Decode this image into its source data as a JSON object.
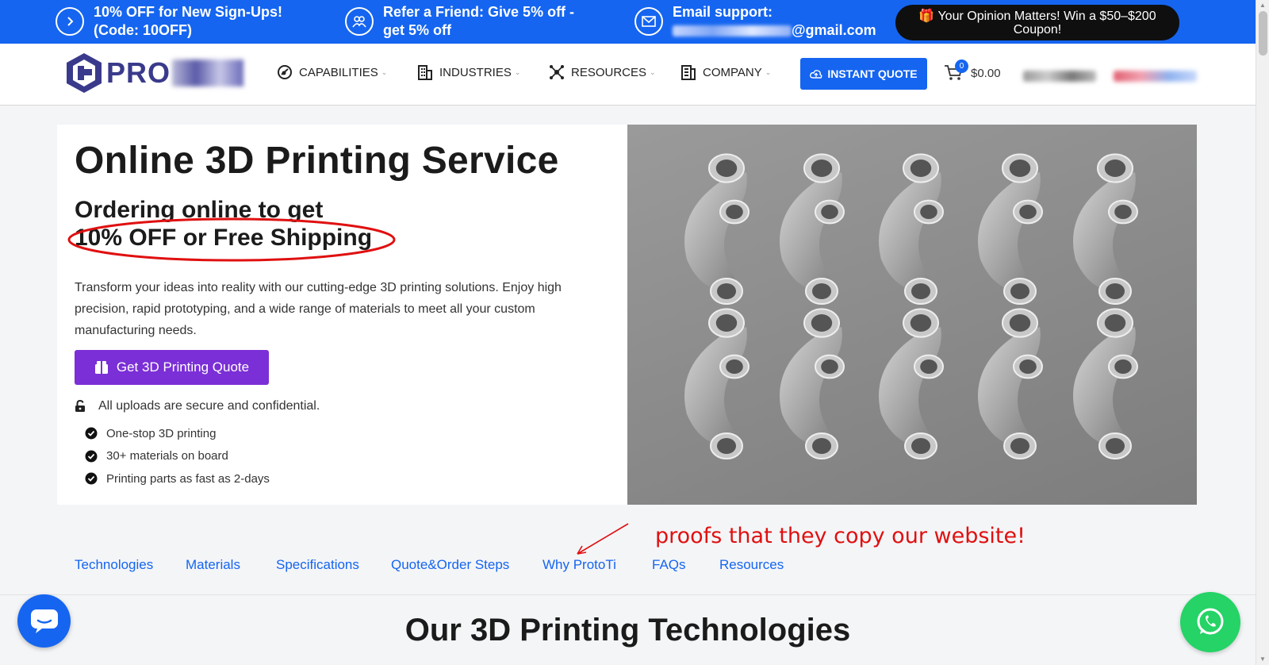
{
  "promo": {
    "item1": "10% OFF for New Sign-Ups! (Code: 10OFF)",
    "item2": "Refer a Friend: Give 5% off - get 5% off",
    "item3_label": "Email support:",
    "item3_email_suffix": "@gmail.com",
    "opinion": "🎁 Your Opinion Matters! Win a $50–$200 Coupon!"
  },
  "header": {
    "logo_text": "PRO",
    "nav": [
      "CAPABILITIES",
      "INDUSTRIES",
      "RESOURCES",
      "COMPANY"
    ],
    "instant_quote": "INSTANT QUOTE",
    "cart_count": "0",
    "cart_amount": "$0.00"
  },
  "hero": {
    "title": "Online 3D Printing Service",
    "subtitle_line1": "Ordering online to get",
    "subtitle_line2": "10% OFF or Free Shipping",
    "description": "Transform your ideas into reality with our cutting-edge 3D printing solutions. Enjoy high precision, rapid prototyping, and a wide range of materials to meet all your custom manufacturing needs.",
    "cta": "Get 3D Printing Quote",
    "secure_note": "All uploads are secure and confidential.",
    "checklist": [
      "One-stop 3D printing",
      "30+ materials on board",
      "Printing parts as fast as 2-days"
    ]
  },
  "tabs": [
    "Technologies",
    "Materials",
    "Specifications",
    "Quote&Order Steps",
    "Why ProtoTi",
    "FAQs",
    "Resources"
  ],
  "annotation": "proofs that they copy our website!",
  "section_title": "Our 3D Printing Technologies",
  "colors": {
    "brand_blue": "#1565f0",
    "cta_purple": "#7b2fd6",
    "whatsapp_green": "#25d366",
    "annotation_red": "#e01010"
  }
}
